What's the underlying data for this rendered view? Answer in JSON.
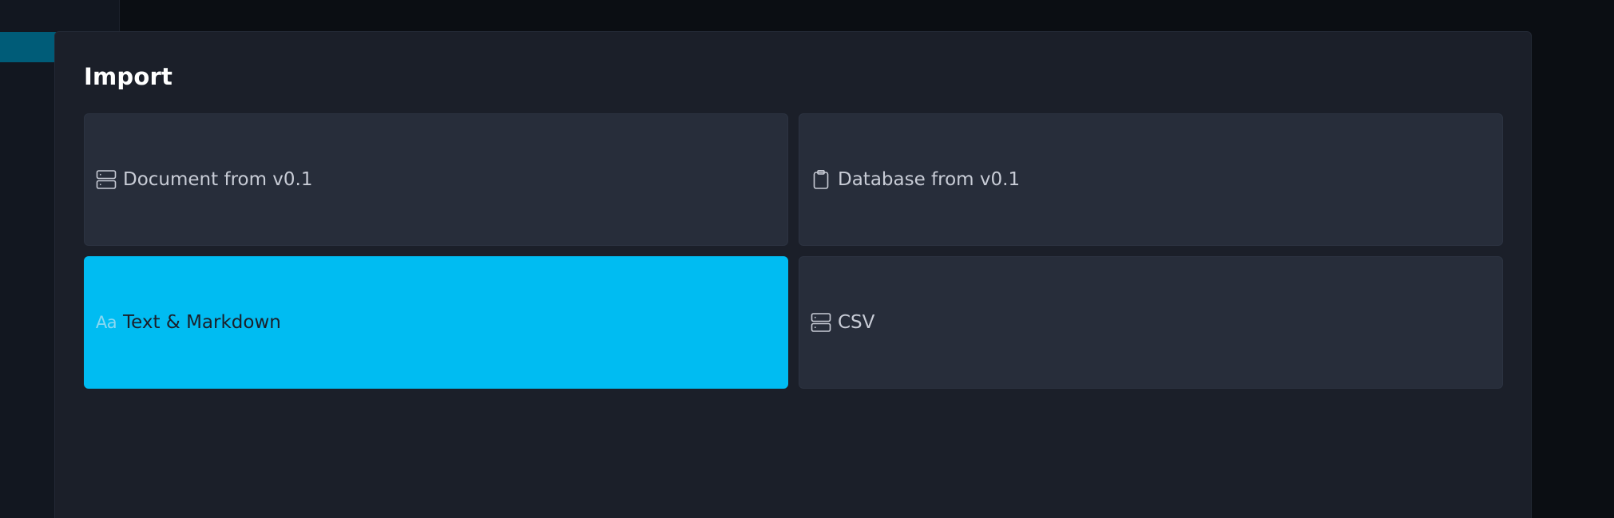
{
  "dialog": {
    "title": "Import"
  },
  "options": [
    {
      "label": "Document from v0.1",
      "icon": "document-icon",
      "selected": false
    },
    {
      "label": "Database from v0.1",
      "icon": "clipboard-icon",
      "selected": false
    },
    {
      "label": "Text & Markdown",
      "icon": "text-aa-icon",
      "icon_text": "Aa",
      "selected": true
    },
    {
      "label": "CSV",
      "icon": "database-icon",
      "selected": false
    }
  ],
  "colors": {
    "accent": "#00bcf2",
    "card": "#272d3a",
    "dialog": "#1b1f29",
    "background": "#0b0e13",
    "sidebar_active": "#005c78"
  }
}
